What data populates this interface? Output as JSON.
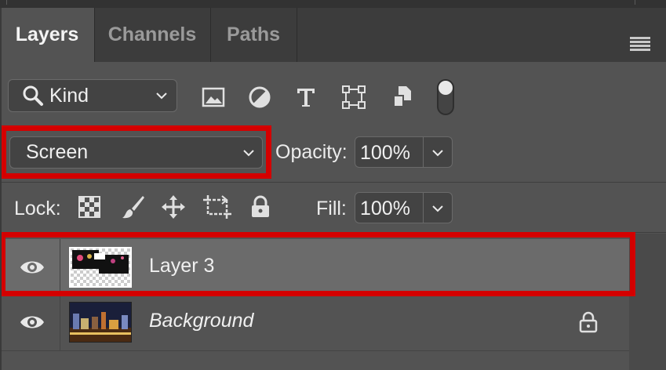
{
  "tabs": [
    {
      "label": "Layers",
      "active": true
    },
    {
      "label": "Channels",
      "active": false
    },
    {
      "label": "Paths",
      "active": false
    }
  ],
  "filter": {
    "kind_label": "Kind",
    "icons": [
      "image-filter-icon",
      "adjustment-filter-icon",
      "type-filter-icon",
      "shape-filter-icon",
      "smart-object-filter-icon"
    ]
  },
  "blend": {
    "mode": "Screen"
  },
  "opacity": {
    "label": "Opacity:",
    "value": "100%"
  },
  "lock": {
    "label": "Lock:",
    "icons": [
      "lock-transparent-pixels-icon",
      "lock-image-pixels-icon",
      "lock-position-icon",
      "lock-artboard-icon",
      "lock-all-icon"
    ]
  },
  "fill": {
    "label": "Fill:",
    "value": "100%"
  },
  "layers": [
    {
      "name": "Layer 3",
      "selected": true,
      "visible": true,
      "italic": false,
      "locked": false
    },
    {
      "name": "Background",
      "selected": false,
      "visible": true,
      "italic": true,
      "locked": true
    }
  ],
  "colors": {
    "panel": "#535353",
    "tabbar": "#3c3c3c",
    "selected_row": "#6b6b6b",
    "highlight": "#d40000"
  }
}
